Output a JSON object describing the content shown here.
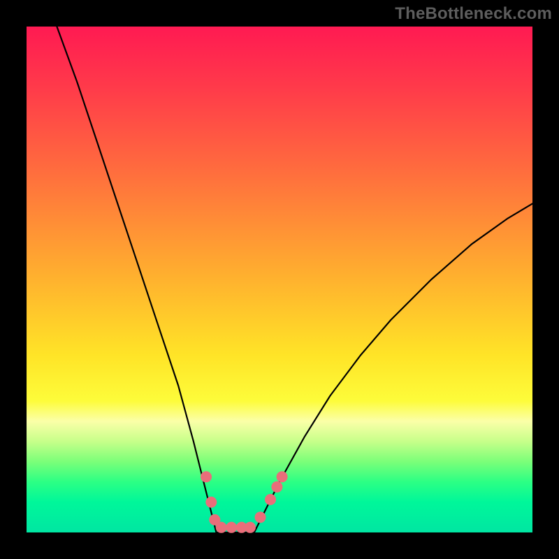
{
  "watermark": "TheBottleneck.com",
  "chart_data": {
    "type": "line",
    "title": "",
    "xlabel": "",
    "ylabel": "",
    "xlim": [
      0,
      100
    ],
    "ylim": [
      0,
      100
    ],
    "background_gradient": {
      "top": "#ff1a52",
      "bottom": "#00e6a2",
      "note": "red-to-green vertical gradient inside black frame"
    },
    "series": [
      {
        "name": "left-branch",
        "x": [
          6,
          10,
          14,
          18,
          22,
          26,
          30,
          33,
          35,
          36.5,
          37.5
        ],
        "y": [
          100,
          89,
          77,
          65,
          53,
          41,
          29,
          18,
          10,
          4,
          0
        ]
      },
      {
        "name": "basin",
        "x": [
          37.5,
          40,
          43,
          45
        ],
        "y": [
          0,
          0,
          0,
          0
        ]
      },
      {
        "name": "right-branch",
        "x": [
          45,
          47,
          50,
          55,
          60,
          66,
          72,
          80,
          88,
          95,
          100
        ],
        "y": [
          0,
          4,
          10,
          19,
          27,
          35,
          42,
          50,
          57,
          62,
          65
        ]
      }
    ],
    "markers": [
      {
        "x": 35.5,
        "y": 11
      },
      {
        "x": 36.5,
        "y": 6
      },
      {
        "x": 37.2,
        "y": 2.5
      },
      {
        "x": 38.5,
        "y": 1
      },
      {
        "x": 40.5,
        "y": 1
      },
      {
        "x": 42.5,
        "y": 1
      },
      {
        "x": 44.2,
        "y": 1
      },
      {
        "x": 46.2,
        "y": 3
      },
      {
        "x": 48.2,
        "y": 6.5
      },
      {
        "x": 49.5,
        "y": 9
      },
      {
        "x": 50.5,
        "y": 11
      }
    ],
    "marker_color": "#e96e7a",
    "marker_radius_px": 8
  }
}
